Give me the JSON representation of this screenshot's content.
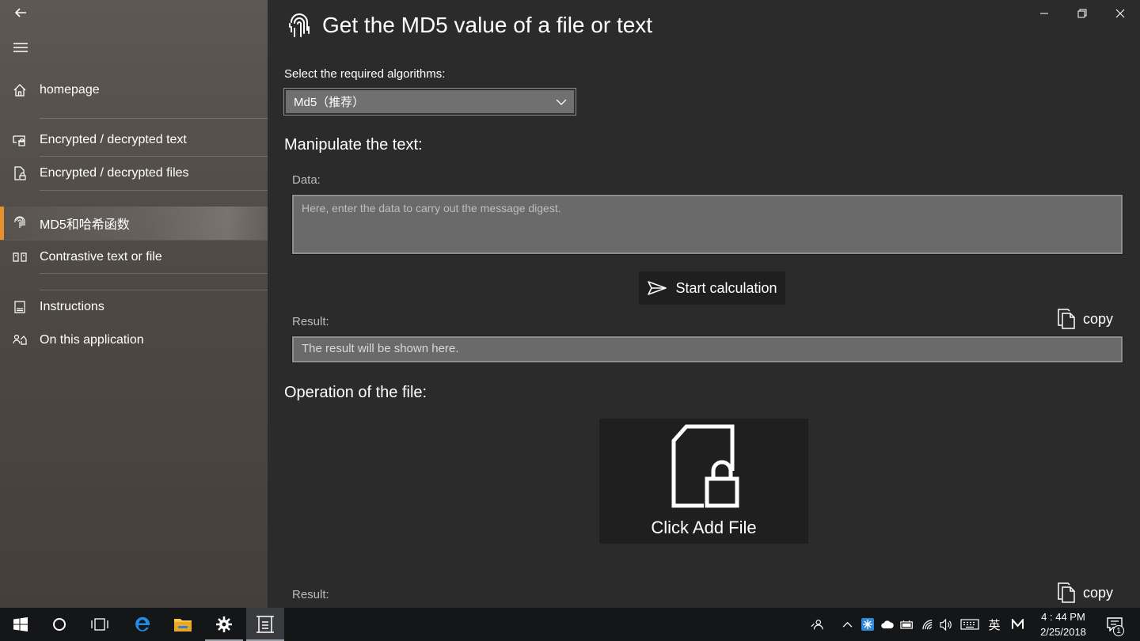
{
  "sidebar": {
    "items": [
      {
        "label": "homepage",
        "icon": "home-icon"
      },
      {
        "label": "Encrypted / decrypted text",
        "icon": "text-encrypt-icon"
      },
      {
        "label": "Encrypted / decrypted files",
        "icon": "file-encrypt-icon"
      },
      {
        "label": "MD5和哈希函数",
        "icon": "fingerprint-icon",
        "active": true
      },
      {
        "label": "Contrastive text or file",
        "icon": "compare-icon"
      },
      {
        "label": "Instructions",
        "icon": "book-icon"
      },
      {
        "label": "On this application",
        "icon": "about-icon"
      }
    ]
  },
  "main": {
    "title": "Get the MD5 value of a file or text",
    "algo_label": "Select the required algorithms:",
    "algo_selected": "Md5（推荐）",
    "text_section": "Manipulate the text:",
    "data_label": "Data:",
    "data_placeholder": "Here, enter the data to carry out the message digest.",
    "start_button": "Start calculation",
    "result_label": "Result:",
    "copy_label": "copy",
    "result_placeholder": "The result will be shown here.",
    "file_section": "Operation of the file:",
    "add_file_label": "Click Add File",
    "file_result_label": "Result:",
    "file_copy_label": "copy"
  },
  "taskbar": {
    "ime": "英",
    "time": "4 : 44 PM",
    "date": "2/25/2018",
    "notification_count": "1"
  },
  "colors": {
    "accent": "#e8912c",
    "main_bg": "#2b2b2b",
    "input_bg": "#6a6a6a",
    "button_bg": "#1f1f1f",
    "taskbar_bg": "#151618"
  }
}
